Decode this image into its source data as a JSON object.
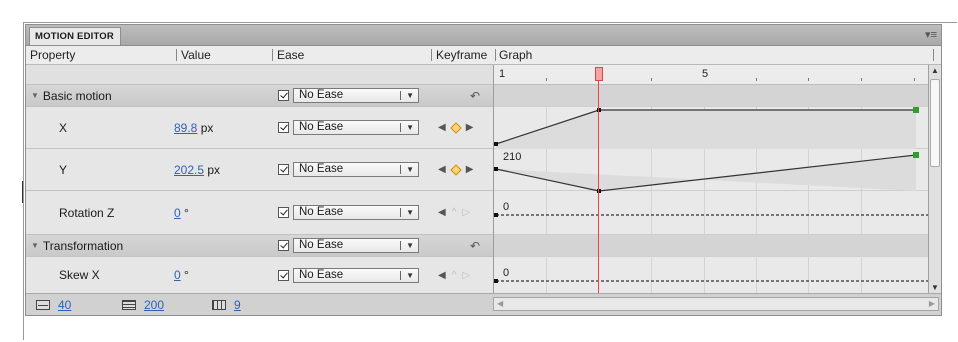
{
  "panel": {
    "tab_label": "MOTION EDITOR",
    "menu_glyph": "▾≡"
  },
  "columns": {
    "property": "Property",
    "value": "Value",
    "ease": "Ease",
    "keyframe": "Keyframe",
    "graph": "Graph"
  },
  "ruler": {
    "label_1": "1",
    "label_5": "5"
  },
  "rows": [
    {
      "type": "category",
      "label": "Basic motion",
      "ease": "No Ease"
    },
    {
      "type": "property",
      "label": "X",
      "value": "89.8",
      "unit": "px",
      "ease": "No Ease"
    },
    {
      "type": "property",
      "label": "Y",
      "value": "202.5",
      "unit": "px",
      "ease": "No Ease"
    },
    {
      "type": "property",
      "label": "Rotation Z",
      "value": "0",
      "unit": "°",
      "ease": "No Ease"
    },
    {
      "type": "category",
      "label": "Transformation",
      "ease": "No Ease"
    },
    {
      "type": "property",
      "label": "Skew X",
      "value": "0",
      "unit": "°",
      "ease": "No Ease"
    }
  ],
  "graph_labels": {
    "y_axis_value": "210",
    "rotation_value": "0",
    "skew_value": "0"
  },
  "footer": {
    "graph_size": "40",
    "expanded_graph_size": "200",
    "viewable_frames": "9"
  },
  "colors": {
    "playhead": "#e24848",
    "keyframe_green": "#2f9e2f",
    "link_blue": "#2f62b5"
  }
}
